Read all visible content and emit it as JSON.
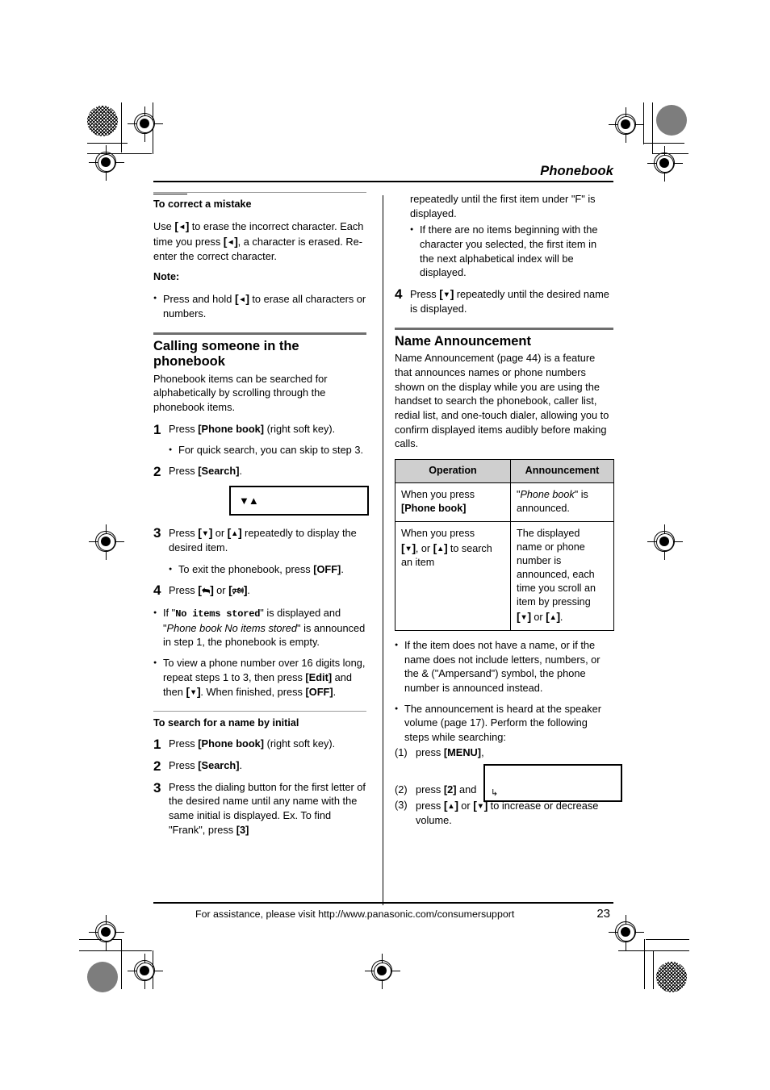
{
  "header": {
    "title": "Phonebook"
  },
  "left_column": {
    "correct_mistake": {
      "heading": "To correct a mistake",
      "para_1": "Use [◄] to erase the incorrect character. Each time you press [◄], a character is erased. Re-enter the correct character.",
      "note_heading": "Note:",
      "note_bullet": "Press and hold [◄] to erase all characters or numbers."
    },
    "calling": {
      "heading": "Calling someone in the phonebook",
      "intro": "Phonebook items can be searched for alphabetically by scrolling through the phonebook items.",
      "steps": [
        {
          "num": "1",
          "text": "Press [Phone book] (right soft key).",
          "bullets": [
            "For quick search, you can skip to step 3."
          ]
        },
        {
          "num": "2",
          "text": "Press [Search].",
          "bullets": []
        },
        {
          "num": "3",
          "text": "Press [▼] or [▲] repeatedly to display the desired item.",
          "bullets": [
            "To exit the phonebook, press [OFF]."
          ]
        },
        {
          "num": "4",
          "text": "Press [handset] or [speakerphone].",
          "bullets": []
        }
      ],
      "display_glyph": "▼▲",
      "after_bullets": [
        "If \"No items stored\" is displayed and \"Phone book No items stored\" is announced in step 1, the phonebook is empty.",
        "To view a phone number over 16 digits long, repeat steps 1 to 3, then press [Edit] and then [▼]. When finished, press [OFF]."
      ]
    },
    "search_initial": {
      "heading": "To search for a name by initial",
      "steps": [
        {
          "num": "1",
          "text": "Press [Phone book] (right soft key)."
        },
        {
          "num": "2",
          "text": "Press [Search]."
        },
        {
          "num": "3",
          "text": "Press the dialing button for the first letter of the desired name until any name with the same initial is displayed. Ex. To find \"Frank\", press [3]"
        }
      ]
    }
  },
  "right_column": {
    "continued": {
      "text": "repeatedly until the first item under \"F\" is displayed.",
      "bullet": "If there are no items beginning with the character you selected, the first item in the next alphabetical index will be displayed.",
      "step_4": {
        "num": "4",
        "text": "Press [▼] repeatedly until the desired name is displayed."
      }
    },
    "name_announcement": {
      "heading": "Name Announcement",
      "intro": "Name Announcement (page 44) is a feature that announces names or phone numbers shown on the display while you are using the handset to search the phonebook, caller list, redial list, and one-touch dialer, allowing you to confirm displayed items audibly before making calls.",
      "table": {
        "headers": [
          "Operation",
          "Announcement"
        ],
        "rows": [
          {
            "operation_lines": [
              "When you press",
              "[Phone book]"
            ],
            "announcement": "\"Phone book\" is announced."
          },
          {
            "operation_lines": [
              "When you press",
              "[▼], or [▲] to",
              "search an item"
            ],
            "announcement": "The displayed name or phone number is announced, each time you scroll an item by pressing [▼] or [▲]."
          }
        ]
      },
      "bullets": [
        "If the item does not have a name, or if the name does not include letters, numbers, or the & (\"Ampersand\") symbol, the phone number is announced instead.",
        "The announcement is heard at the speaker volume (page 17). Perform the following steps while searching:"
      ],
      "numbered_steps": [
        {
          "label": "(1)",
          "text": "press [MENU],"
        },
        {
          "label": "(2)",
          "text": "press [2] and"
        },
        {
          "label": "(3)",
          "text": "press [▲] or [▼] to increase or decrease volume."
        }
      ],
      "display_glyph": "⌐"
    }
  },
  "footer": {
    "assistance_text": "For assistance, please visit http://www.panasonic.com/consumersupport",
    "page_number": "23"
  }
}
